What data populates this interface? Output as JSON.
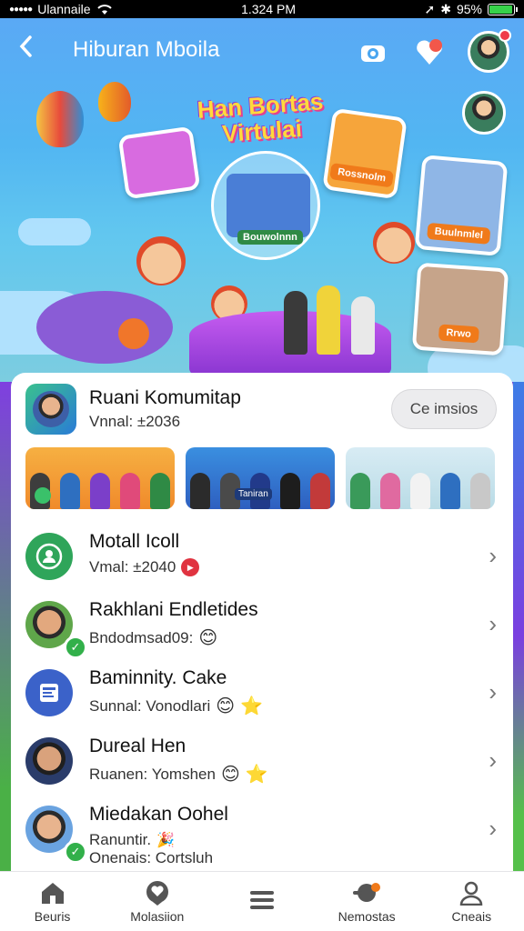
{
  "status_bar": {
    "carrier": "Ulannaile",
    "time": "1.324 PM",
    "battery": "95%",
    "battery_level": 0.95
  },
  "header": {
    "title": "Hiburan Mboila",
    "back_icon": "chevron-left-icon",
    "actions": [
      "camera-icon",
      "heart-icon",
      "profile-avatar"
    ]
  },
  "hero": {
    "title": "Han Bortas Virtulai",
    "cards": [
      {
        "label": "Rossnolm"
      },
      {
        "label": "Buulnmlel"
      },
      {
        "label": "Rrwo"
      }
    ],
    "center_label": "Bouwolnnn"
  },
  "community": {
    "name": "Ruani Komumitap",
    "subtitle": "Vnnal: ±2036",
    "action_label": "Ce imsios"
  },
  "thumbnails": [
    {
      "label": "",
      "bg": "#f2a93b"
    },
    {
      "label": "Taniran",
      "bg": "#2e6fc0"
    },
    {
      "label": "",
      "bg": "#cfe5ef"
    }
  ],
  "list": [
    {
      "title": "Motall Icoll",
      "subtitle": "Vmal: ±2040",
      "avatar": "group-icon",
      "badge": "record"
    },
    {
      "title": "Rakhlani Endletides",
      "subtitle": "Bndodmsad09:",
      "avatar": "person-photo",
      "badge": "smile",
      "verified": true
    },
    {
      "title": "Baminnity. Cake",
      "subtitle": "Sunnal: Vonodlari",
      "avatar": "document-icon",
      "badge": "smile-star"
    },
    {
      "title": "Dureal Hen",
      "subtitle": "Ruanen: Yomshen",
      "avatar": "person-photo",
      "badge": "smile-star"
    },
    {
      "title": "Miedakan Oohel",
      "subtitle": "Ranuntir.",
      "subtitle2": "Onenais: Cortsluh",
      "avatar": "person-photo",
      "verified": true
    }
  ],
  "bottom_nav": [
    {
      "label": "Beuris",
      "icon": "home-icon"
    },
    {
      "label": "Molasiion",
      "icon": "chat-icon"
    },
    {
      "label": "",
      "icon": "menu-icon"
    },
    {
      "label": "Nemostas",
      "icon": "games-icon"
    },
    {
      "label": "Cneais",
      "icon": "user-icon"
    }
  ],
  "colors": {
    "accent": "#3d7de6",
    "brand_purple": "#6b3fd6",
    "verified_green": "#32b04a",
    "record_red": "#e03340"
  }
}
